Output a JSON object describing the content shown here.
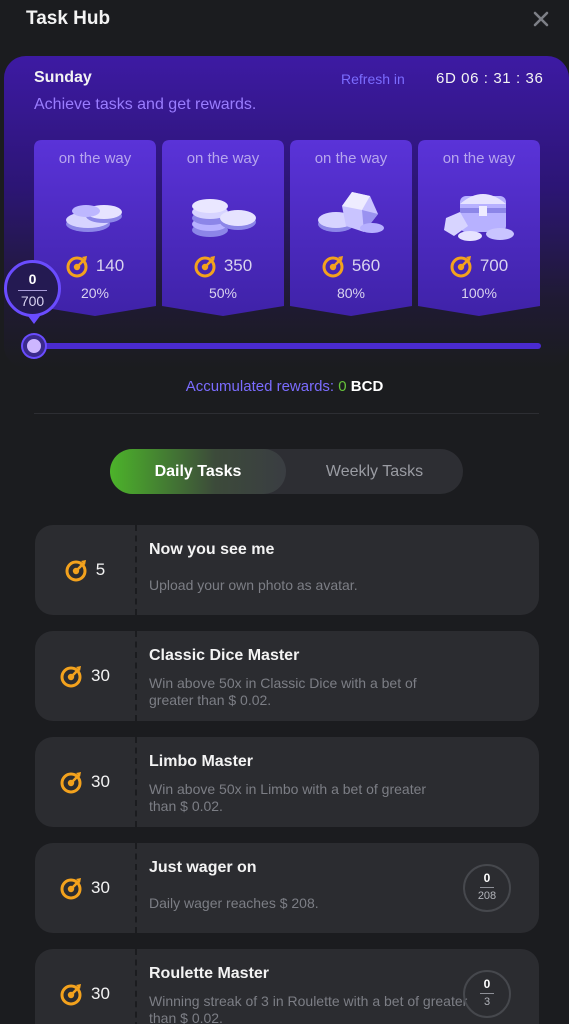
{
  "header": {
    "title": "Task Hub"
  },
  "card": {
    "day": "Sunday",
    "subtitle": "Achieve tasks and get rewards.",
    "refresh_label": "Refresh in",
    "timer": "6D 06 : 31 : 36",
    "progress": {
      "current": "0",
      "total": "700"
    },
    "tiers": [
      {
        "label": "on the way",
        "amount": "140",
        "percent": "20%",
        "icon": "coins-icon"
      },
      {
        "label": "on the way",
        "amount": "350",
        "percent": "50%",
        "icon": "coin-stack-icon"
      },
      {
        "label": "on the way",
        "amount": "560",
        "percent": "80%",
        "icon": "gems-icon"
      },
      {
        "label": "on the way",
        "amount": "700",
        "percent": "100%",
        "icon": "treasure-chest-icon"
      }
    ]
  },
  "accumulated": {
    "label": "Accumulated rewards:",
    "value": "0",
    "unit": "BCD"
  },
  "tabs": {
    "daily": "Daily Tasks",
    "weekly": "Weekly Tasks"
  },
  "tasks": [
    {
      "reward": "5",
      "title": "Now you see me",
      "desc": "Upload your own photo as avatar."
    },
    {
      "reward": "30",
      "title": "Classic Dice Master",
      "desc": "Win above 50x in Classic Dice with a bet of greater than $ 0.02."
    },
    {
      "reward": "30",
      "title": "Limbo Master",
      "desc": "Win above 50x in Limbo with a bet of greater than $ 0.02."
    },
    {
      "reward": "30",
      "title": "Just wager on",
      "desc": "Daily wager reaches $ 208.",
      "counter": {
        "current": "0",
        "total": "208"
      }
    },
    {
      "reward": "30",
      "title": "Roulette Master",
      "desc": "Winning streak of 3 in Roulette with a bet of greater than $ 0.02.",
      "counter": {
        "current": "0",
        "total": "3"
      }
    }
  ],
  "colors": {
    "accent_purple": "#6a4cff",
    "green": "#4cb32a",
    "target_orange": "#f3a21d"
  }
}
